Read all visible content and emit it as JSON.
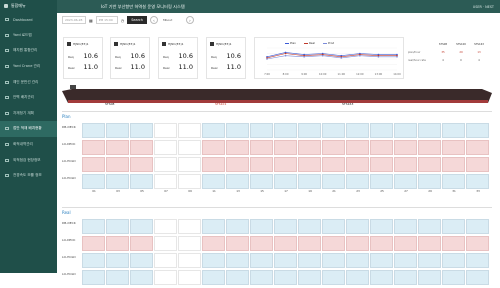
{
  "app": {
    "title": "IoT 기반 부산항만 하역설 운영 모니터링 시스템",
    "user": "USER · NEST"
  },
  "sidebar": {
    "logo": "통합메뉴",
    "items": [
      {
        "label": "Dashboard"
      },
      {
        "label": "Yard 로드맵"
      },
      {
        "label": "해지원 통합관리"
      },
      {
        "label": "Yard Crane 관리"
      },
      {
        "label": "예인 운반선 관리"
      },
      {
        "label": "안벽 배치관리"
      },
      {
        "label": "자재정기 계획"
      },
      {
        "label": "접안 적재 배치현황"
      },
      {
        "label": "화적내역관리"
      },
      {
        "label": "외적점검 현장정보"
      },
      {
        "label": "전경속도 모를 정보"
      }
    ],
    "active_index": 7
  },
  "filter": {
    "date": "2023-06-28",
    "time": "PM 15:00",
    "search_label": "Search",
    "prev": "‹",
    "next": "›",
    "mode": "Mbout"
  },
  "cards": [
    {
      "name": "HJNC(E3)1",
      "req_label": "Req",
      "req": "10.6",
      "real_label": "Real",
      "real": "11.0"
    },
    {
      "name": "HJNC(E3)1",
      "req_label": "Req",
      "req": "10.6",
      "real_label": "Real",
      "real": "11.0"
    },
    {
      "name": "HJNC(E3)1",
      "req_label": "Req",
      "req": "10.6",
      "real_label": "Real",
      "real": "11.0"
    },
    {
      "name": "HJNC(E3)1",
      "req_label": "Req",
      "req": "10.6",
      "real_label": "Real",
      "real": "11.0"
    }
  ],
  "chart_data": {
    "type": "line",
    "x": [
      "7:00",
      "8:00",
      "9:00",
      "10:00",
      "11:00",
      "12:00",
      "13:00",
      "14:00"
    ],
    "series": [
      {
        "name": "Plan",
        "color": "#3b5bd6",
        "values": [
          12,
          16,
          14,
          15,
          13,
          15,
          14,
          14
        ]
      },
      {
        "name": "Real",
        "color": "#c0392b",
        "values": [
          11,
          15,
          13,
          14,
          12,
          14,
          13,
          13
        ]
      },
      {
        "name": "Prod",
        "color": "#7b8bd9",
        "values": [
          10,
          13,
          12,
          13,
          11,
          13,
          12,
          12
        ]
      }
    ],
    "ylim": [
      0,
      20
    ]
  },
  "summary": {
    "headers": [
      "",
      "STS08",
      "STS100",
      "STS163"
    ],
    "rows": [
      {
        "label": "plan/hour",
        "values": [
          "35",
          "29",
          "13"
        ]
      },
      {
        "label": "real/hour rate",
        "values": [
          "4",
          "0",
          "4"
        ]
      }
    ]
  },
  "ship": {
    "cranes": [
      "STS08",
      "STS101",
      "STS163"
    ]
  },
  "sections": {
    "plan": "Plan",
    "real": "Real"
  },
  "rows": [
    "DB-DECK",
    "LO-DECK",
    "LO-HOLD",
    "LO-HOLD"
  ],
  "bays": [
    "01",
    "03",
    "05",
    "07",
    "09",
    "11",
    "13",
    "15",
    "17",
    "19",
    "21",
    "23",
    "25",
    "27",
    "29",
    "31",
    "33"
  ],
  "colors": {
    "sidebar": "#1f4f49",
    "topbar": "#2c5b55",
    "plan_cell": "#dbedf5",
    "real_cell": "#f5d8d8"
  }
}
